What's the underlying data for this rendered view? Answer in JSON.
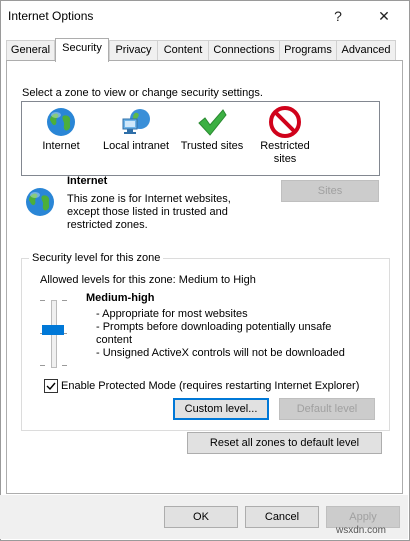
{
  "window": {
    "title": "Internet Options",
    "help_glyph": "?",
    "close_glyph": "✕"
  },
  "tabs": [
    {
      "label": "General"
    },
    {
      "label": "Security"
    },
    {
      "label": "Privacy"
    },
    {
      "label": "Content"
    },
    {
      "label": "Connections"
    },
    {
      "label": "Programs"
    },
    {
      "label": "Advanced"
    }
  ],
  "security": {
    "prompt": "Select a zone to view or change security settings.",
    "zones": [
      {
        "label": "Internet",
        "icon": "globe-icon"
      },
      {
        "label": "Local intranet",
        "icon": "network-computer-icon"
      },
      {
        "label": "Trusted sites",
        "icon": "green-check-icon"
      },
      {
        "label": "Restricted sites",
        "icon": "restricted-icon"
      }
    ],
    "selected_zone": {
      "name": "Internet",
      "description": "This zone is for Internet websites, except those listed in trusted and restricted zones."
    },
    "sites_button": "Sites",
    "level_group": {
      "legend": "Security level for this zone",
      "allowed": "Allowed levels for this zone: Medium to High",
      "level_name": "Medium-high",
      "bullets": [
        "- Appropriate for most websites",
        "- Prompts before downloading potentially unsafe content",
        "- Unsigned ActiveX controls will not be downloaded"
      ],
      "protected_mode_label": "Enable Protected Mode (requires restarting Internet Explorer)",
      "protected_mode_checked": true,
      "custom_level_button": "Custom level...",
      "default_level_button": "Default level"
    },
    "reset_all_button": "Reset all zones to default level"
  },
  "footer": {
    "ok": "OK",
    "cancel": "Cancel",
    "apply": "Apply",
    "watermark": "wsxdn.com"
  },
  "colors": {
    "accent": "#0078d7",
    "check": "#3cb043",
    "restricted": "#d0021b"
  }
}
